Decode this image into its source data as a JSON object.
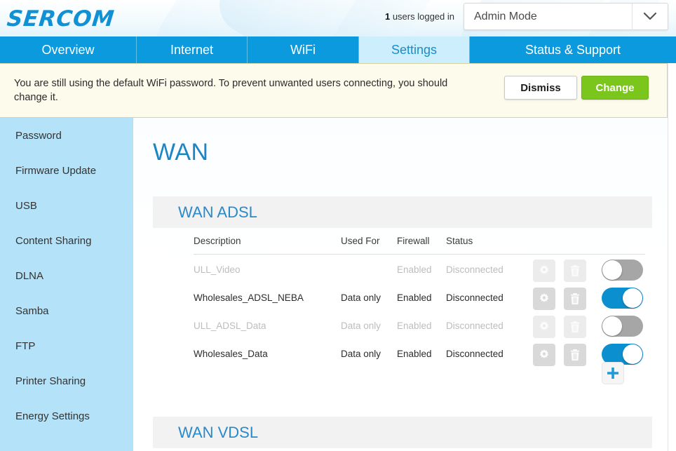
{
  "header": {
    "logo_text": "SERCOM",
    "users_count": "1",
    "users_label": " users logged in",
    "mode_selected": "Admin Mode",
    "chevron_icon": "chevron-down-icon"
  },
  "tabs": [
    {
      "label": "Overview",
      "active": false
    },
    {
      "label": "Internet",
      "active": false
    },
    {
      "label": "WiFi",
      "active": false
    },
    {
      "label": "Settings",
      "active": true
    },
    {
      "label": "Status & Support",
      "active": false
    }
  ],
  "banner": {
    "message": "You are still using the default WiFi password. To prevent unwanted users connecting, you should change it.",
    "dismiss_label": "Dismiss",
    "change_label": "Change",
    "bg_color": "#fdfbeb",
    "change_color": "#7ac61d"
  },
  "sidebar": {
    "items": [
      {
        "label": "Password"
      },
      {
        "label": "Firmware Update"
      },
      {
        "label": "USB"
      },
      {
        "label": "Content Sharing"
      },
      {
        "label": "DLNA"
      },
      {
        "label": "Samba"
      },
      {
        "label": "FTP"
      },
      {
        "label": "Printer Sharing"
      },
      {
        "label": "Energy Settings"
      }
    ]
  },
  "main": {
    "page_title": "WAN",
    "accent_color": "#1b86c6",
    "sections": [
      {
        "title": "WAN ADSL",
        "columns": [
          "Description",
          "Used For",
          "Firewall",
          "Status"
        ],
        "rows": [
          {
            "description": "ULL_Video",
            "used_for": "",
            "firewall": "Enabled",
            "status": "Disconnected",
            "enabled": false,
            "toggle_on": false
          },
          {
            "description": "Wholesales_ADSL_NEBA",
            "used_for": "Data only",
            "firewall": "Enabled",
            "status": "Disconnected",
            "enabled": true,
            "toggle_on": true
          },
          {
            "description": "ULL_ADSL_Data",
            "used_for": "Data only",
            "firewall": "Enabled",
            "status": "Disconnected",
            "enabled": false,
            "toggle_on": false
          },
          {
            "description": "Wholesales_Data",
            "used_for": "Data only",
            "firewall": "Enabled",
            "status": "Disconnected",
            "enabled": true,
            "toggle_on": true
          }
        ],
        "add_icon": "plus-icon",
        "row_icons": [
          "gear-icon",
          "trash-icon",
          "toggle-switch"
        ]
      },
      {
        "title": "WAN VDSL",
        "columns": [],
        "rows": []
      }
    ]
  }
}
